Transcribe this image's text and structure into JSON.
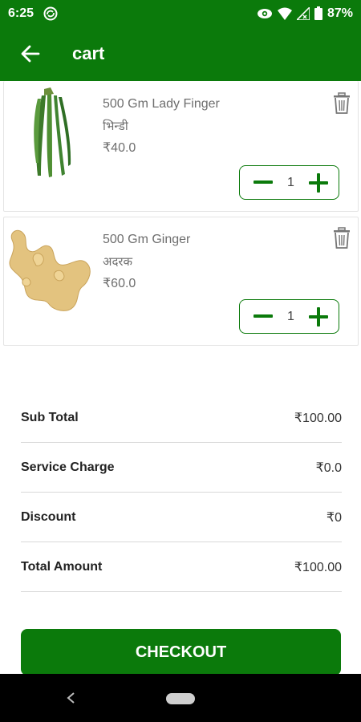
{
  "status_bar": {
    "time": "6:25",
    "battery": "87%"
  },
  "app_bar": {
    "title": "cart"
  },
  "cart_items": [
    {
      "name": "500 Gm Lady Finger",
      "hindi_name": "भिन्डी",
      "price": "₹40.0",
      "quantity": "1"
    },
    {
      "name": "500 Gm Ginger",
      "hindi_name": "अदरक",
      "price": "₹60.0",
      "quantity": "1"
    }
  ],
  "summary": [
    {
      "label": "Sub Total",
      "value": "₹100.00"
    },
    {
      "label": "Service Charge",
      "value": "₹0.0"
    },
    {
      "label": "Discount",
      "value": "₹0"
    },
    {
      "label": "Total Amount",
      "value": "₹100.00"
    }
  ],
  "checkout_label": "CHECKOUT",
  "colors": {
    "primary_green": "#0b7a0b",
    "text_gray": "#6e6e6e"
  }
}
